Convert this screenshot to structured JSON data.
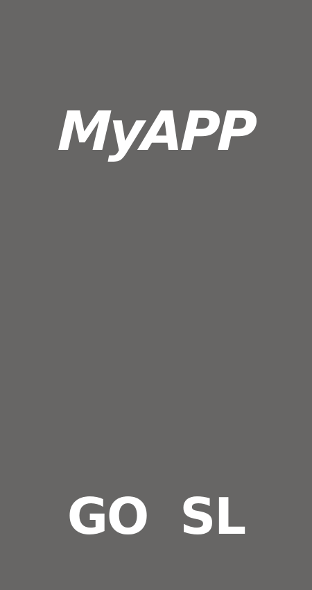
{
  "app": {
    "title": "MyAPP",
    "footer_brand": "GO  SL"
  },
  "colors": {
    "background": "#676665",
    "text": "#ffffff"
  }
}
